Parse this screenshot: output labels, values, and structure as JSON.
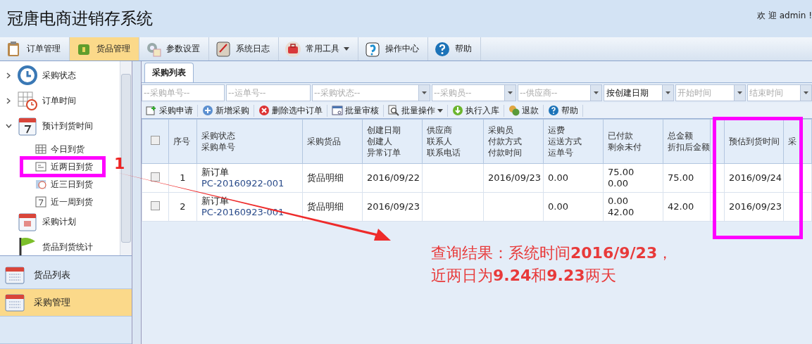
{
  "header": {
    "title": "冠唐电商进销存系统",
    "welcome": "欢 迎 admin !"
  },
  "nav": [
    {
      "label": "订单管理",
      "selected": false
    },
    {
      "label": "货品管理",
      "selected": true
    },
    {
      "label": "参数设置",
      "selected": false
    },
    {
      "label": "系统日志",
      "selected": false
    },
    {
      "label": "常用工具",
      "selected": false,
      "has_menu": true
    },
    {
      "label": "操作中心",
      "selected": false
    },
    {
      "label": "帮助",
      "selected": false
    }
  ],
  "tree": [
    {
      "label": "采购状态",
      "expanded": false
    },
    {
      "label": "订单时间",
      "expanded": false
    },
    {
      "label": "预计到货时间",
      "expanded": true,
      "children": [
        {
          "label": "今日到货"
        },
        {
          "label": "近两日到货"
        },
        {
          "label": "近三日到货"
        },
        {
          "label": "近一周到货"
        }
      ]
    },
    {
      "label": "采购计划"
    },
    {
      "label": "货品到货统计"
    }
  ],
  "accordion": [
    {
      "label": "货品列表",
      "selected": false
    },
    {
      "label": "采购管理",
      "selected": true
    }
  ],
  "tabs": [
    {
      "label": "采购列表",
      "selected": true
    }
  ],
  "filters": [
    {
      "kind": "input",
      "placeholder": "--采购单号--"
    },
    {
      "kind": "input",
      "placeholder": "--运单号--"
    },
    {
      "kind": "select",
      "placeholder": "--采购状态--"
    },
    {
      "kind": "select",
      "placeholder": "--采购员--"
    },
    {
      "kind": "select",
      "placeholder": "--供应商--"
    },
    {
      "kind": "select",
      "value": "按创建日期"
    },
    {
      "kind": "select",
      "placeholder": "开始时间"
    },
    {
      "kind": "select",
      "placeholder": "结束时间"
    }
  ],
  "actions": [
    {
      "label": "采购申请"
    },
    {
      "label": "新增采购"
    },
    {
      "label": "删除选中订单"
    },
    {
      "label": "批量审核"
    },
    {
      "label": "批量操作",
      "has_menu": true
    },
    {
      "label": "执行入库"
    },
    {
      "label": "退款"
    },
    {
      "label": "帮助"
    }
  ],
  "table": {
    "header_checked": false,
    "columns": [
      {
        "lines": [
          "序号"
        ]
      },
      {
        "lines": [
          "采购状态",
          "采购单号"
        ]
      },
      {
        "lines": [
          "采购货品"
        ]
      },
      {
        "lines": [
          "创建日期",
          "创建人",
          "异常订单"
        ]
      },
      {
        "lines": [
          "供应商",
          "联系人",
          "联系电话"
        ]
      },
      {
        "lines": [
          "采购员",
          "付款方式",
          "付款时间"
        ]
      },
      {
        "lines": [
          "运费",
          "运送方式",
          "运单号"
        ]
      },
      {
        "lines": [
          "已付款",
          "剩余未付"
        ]
      },
      {
        "lines": [
          "总金额",
          "折扣后金额"
        ]
      },
      {},
      {
        "lines": [
          "预估到货时间"
        ]
      },
      {
        "lines": [
          "采"
        ]
      }
    ],
    "rows": [
      {
        "checked": false,
        "cells": [
          [
            "1"
          ],
          [
            "新订单",
            "PC-20160922-001"
          ],
          [
            "货品明细"
          ],
          [
            "2016/09/22"
          ],
          [],
          [
            "2016/09/23"
          ],
          [
            "0.00"
          ],
          [
            "75.00",
            "0.00"
          ],
          [
            "75.00"
          ],
          [],
          [
            "2016/09/24"
          ],
          []
        ]
      },
      {
        "checked": false,
        "cells": [
          [
            "2"
          ],
          [
            "新订单",
            "PC-20160923-001"
          ],
          [
            "货品明细"
          ],
          [
            "2016/09/23"
          ],
          [],
          [],
          [
            "0.00"
          ],
          [
            "0.00",
            "42.00"
          ],
          [
            "42.00"
          ],
          [],
          [
            "2016/09/23"
          ],
          []
        ]
      }
    ]
  },
  "annotation": {
    "marker": "1",
    "note": [
      "查询结果：系统时间**2016/9/23**，",
      "近两日为**9.24**和**9.23**两天"
    ]
  }
}
